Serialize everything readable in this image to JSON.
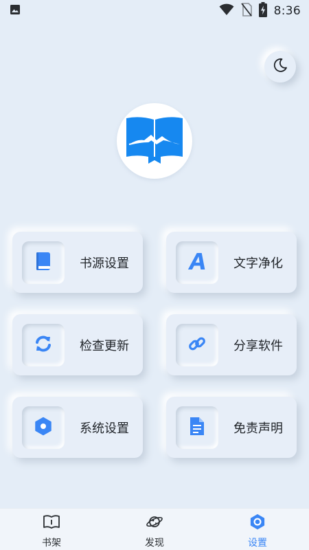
{
  "status_bar": {
    "time": "8:36",
    "icons": [
      "image-icon",
      "wifi-icon",
      "no-sim-icon",
      "battery-charging-icon"
    ]
  },
  "theme_toggle": {
    "icon": "moon-icon"
  },
  "logo": {
    "icon": "book-mountain-logo"
  },
  "menu": [
    {
      "label": "书源设置",
      "icon": "book-icon"
    },
    {
      "label": "文字净化",
      "icon": "letter-a-icon"
    },
    {
      "label": "检查更新",
      "icon": "refresh-icon"
    },
    {
      "label": "分享软件",
      "icon": "link-icon"
    },
    {
      "label": "系统设置",
      "icon": "settings-hex-icon"
    },
    {
      "label": "免责声明",
      "icon": "document-icon"
    }
  ],
  "bottom_nav": [
    {
      "label": "书架",
      "icon": "bookshelf-icon",
      "active": false
    },
    {
      "label": "发现",
      "icon": "planet-icon",
      "active": false
    },
    {
      "label": "设置",
      "icon": "settings-hex-icon",
      "active": true
    }
  ],
  "colors": {
    "background": "#e4edf7",
    "accent": "#3a86f5",
    "logo_blue": "#1688f0"
  }
}
